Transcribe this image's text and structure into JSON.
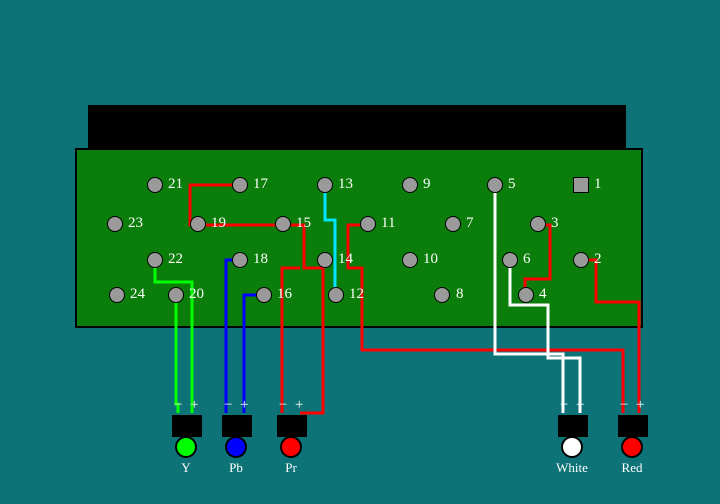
{
  "pins": {
    "p1": "1",
    "p2": "2",
    "p3": "3",
    "p4": "4",
    "p5": "5",
    "p6": "6",
    "p7": "7",
    "p8": "8",
    "p9": "9",
    "p10": "10",
    "p11": "11",
    "p12": "12",
    "p13": "13",
    "p14": "14",
    "p15": "15",
    "p16": "16",
    "p17": "17",
    "p18": "18",
    "p19": "19",
    "p20": "20",
    "p21": "21",
    "p22": "22",
    "p23": "23",
    "p24": "24"
  },
  "jacks": {
    "y": {
      "label": "Y",
      "color": "#00ff00"
    },
    "pb": {
      "label": "Pb",
      "color": "#0000ff"
    },
    "pr": {
      "label": "Pr",
      "color": "#ff0000"
    },
    "white": {
      "label": "White",
      "color": "#ffffff"
    },
    "red": {
      "label": "Red",
      "color": "#ff0000"
    }
  },
  "signs": {
    "minus": "−",
    "plus": "+"
  }
}
